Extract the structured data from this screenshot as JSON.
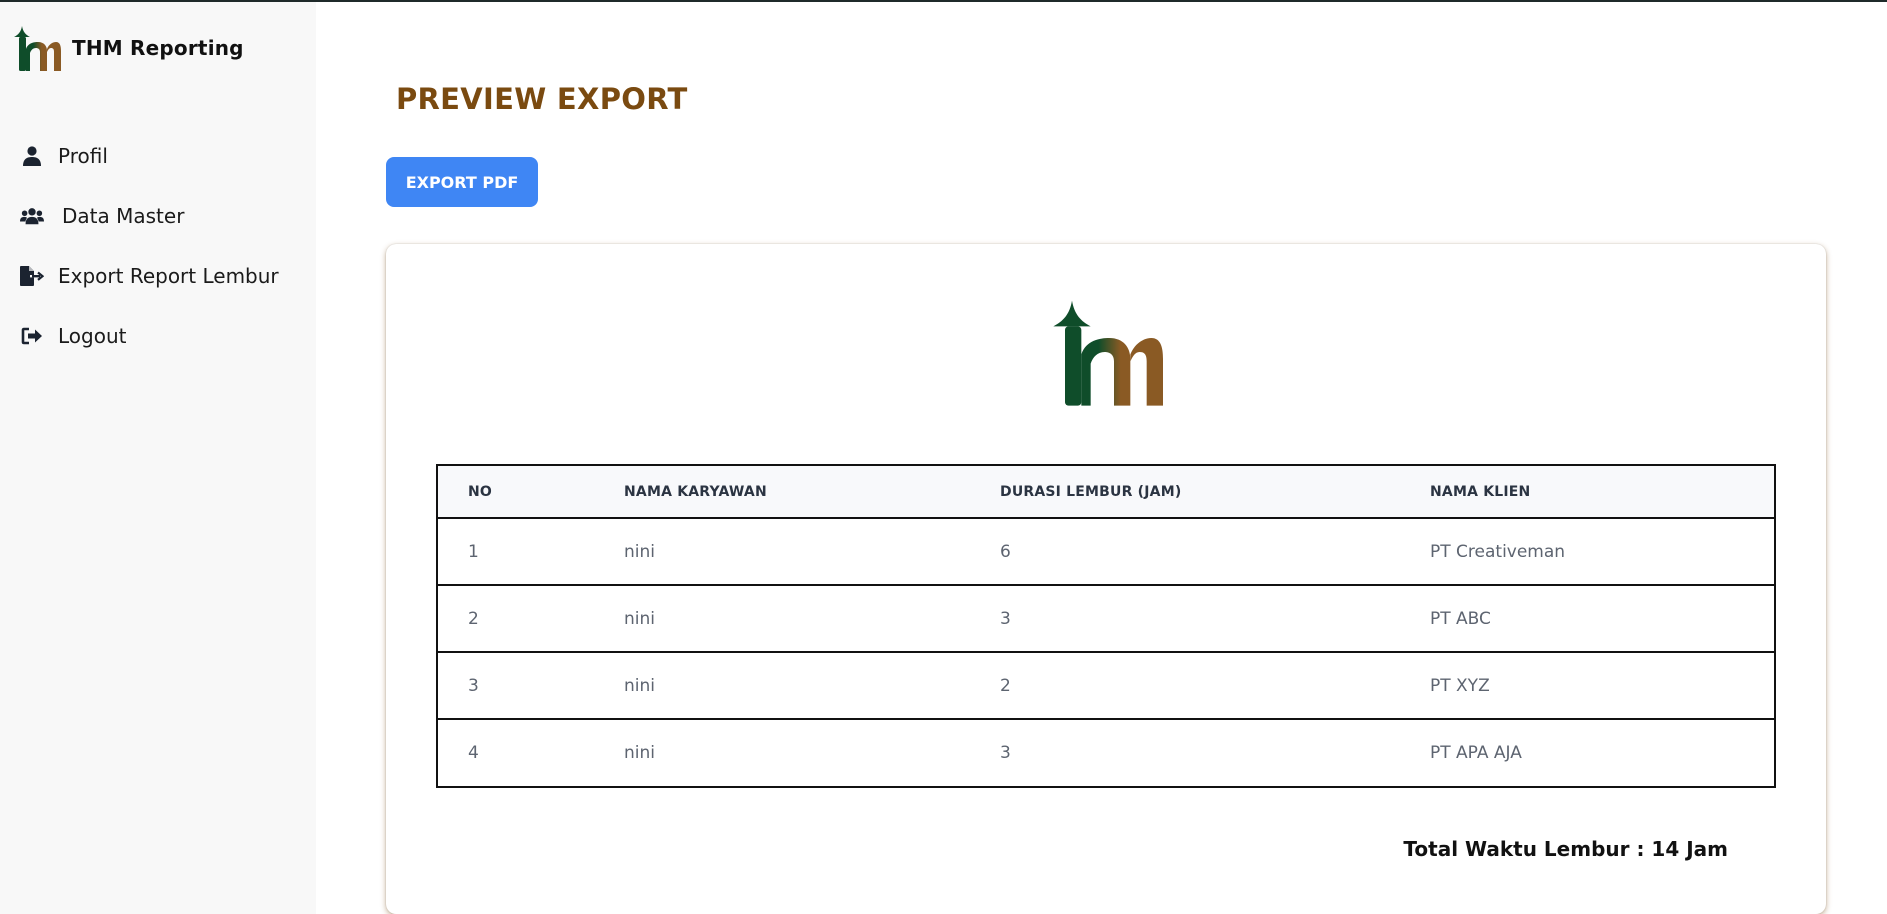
{
  "app": {
    "brand_name": "THM Reporting"
  },
  "sidebar": {
    "items": [
      {
        "label": "Profil",
        "icon": "user-icon"
      },
      {
        "label": "Data Master",
        "icon": "users-icon"
      },
      {
        "label": "Export Report Lembur",
        "icon": "file-export-icon"
      },
      {
        "label": "Logout",
        "icon": "logout-icon"
      }
    ]
  },
  "main": {
    "title": "PREVIEW EXPORT",
    "export_button_label": "EXPORT PDF",
    "table": {
      "headers": [
        "NO",
        "NAMA KARYAWAN",
        "DURASI LEMBUR (JAM)",
        "NAMA KLIEN"
      ],
      "rows": [
        [
          "1",
          "nini",
          "6",
          "PT Creativeman"
        ],
        [
          "2",
          "nini",
          "3",
          "PT ABC"
        ],
        [
          "3",
          "nini",
          "2",
          "PT XYZ"
        ],
        [
          "4",
          "nini",
          "3",
          "PT APA AJA"
        ]
      ]
    },
    "total_text": "Total Waktu Lembur : 14 Jam"
  },
  "colors": {
    "brand_green": "#0f4d2a",
    "brand_brown": "#8a5a24",
    "title_brown": "#7a4a10",
    "button_blue": "#3f86f4"
  }
}
